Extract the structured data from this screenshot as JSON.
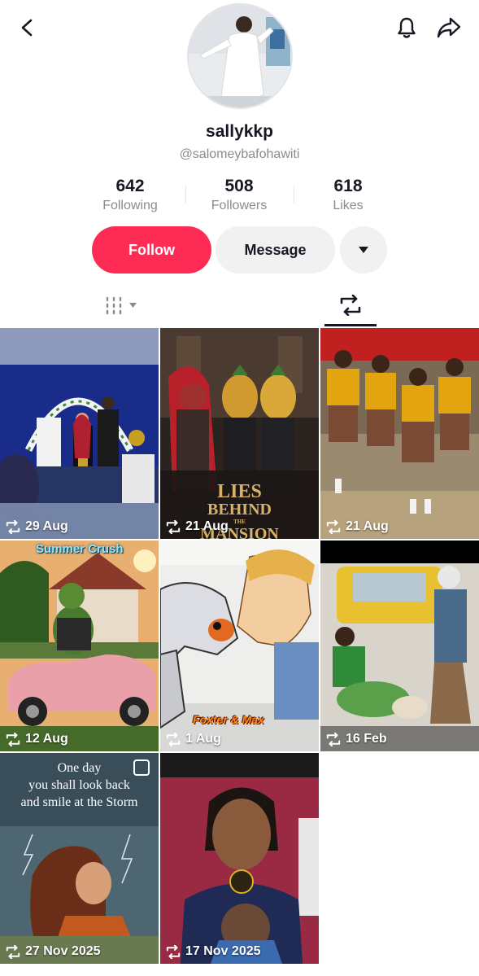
{
  "header": {
    "back_icon": "chevron-left-icon",
    "notification_icon": "bell-icon",
    "share_icon": "share-arrow-icon"
  },
  "profile": {
    "username": "sallykkp",
    "handle": "@salomeybafohawiti",
    "stats": [
      {
        "value": "642",
        "label": "Following"
      },
      {
        "value": "508",
        "label": "Followers"
      },
      {
        "value": "618",
        "label": "Likes"
      }
    ]
  },
  "actions": {
    "follow_label": "Follow",
    "message_label": "Message",
    "more_icon": "caret-down-icon"
  },
  "colors": {
    "follow": "#fe2c55",
    "secondary_bg": "#f1f1f2",
    "muted_text": "#8a8b91"
  },
  "tabs": [
    {
      "icon": "grid-icon",
      "selected": false
    },
    {
      "icon": "repost-icon",
      "selected": true
    }
  ],
  "videos": [
    {
      "date": "29 Aug"
    },
    {
      "date": "21 Aug",
      "overlay_line1": "LIES",
      "overlay_line2": "BEHIND",
      "overlay_line3": "MANSION",
      "overlay_small": "THE"
    },
    {
      "date": "21 Aug"
    },
    {
      "date": "12 Aug",
      "overlay": "Summer Crush"
    },
    {
      "date": "1 Aug",
      "overlay": "Foxter & Max"
    },
    {
      "date": "16 Feb"
    },
    {
      "date": "27 Nov 2025",
      "overlay_line1": "One day",
      "overlay_line2": "you shall look back",
      "overlay_line3": "and smile at the Storm"
    },
    {
      "date": "17 Nov 2025"
    }
  ]
}
